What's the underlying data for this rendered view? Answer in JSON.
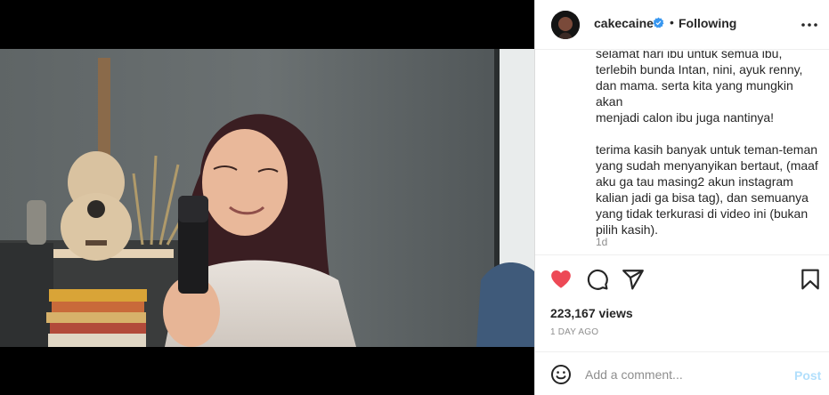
{
  "header": {
    "username": "cakecaine",
    "separator": "•",
    "follow_status": "Following",
    "verified": true
  },
  "caption": {
    "text": "selamat hari ibu untuk semua ibu,\nterlebih bunda Intan, nini, ayuk renny,\ndan mama. serta kita yang mungkin akan\nmenjadi calon ibu juga nantinya!\n\nterima kasih banyak untuk teman-teman\nyang sudah menyanyikan bertaut, (maaf\naku ga tau masing2 akun instagram\nkalian jadi ga bisa tag), dan semuanya\nyang tidak terkurasi di video ini (bukan\npilih kasih).",
    "time": "1d"
  },
  "actions": {
    "liked": true,
    "icons": [
      "heart-icon",
      "comment-icon",
      "share-icon",
      "bookmark-icon"
    ],
    "like_color": "#ed4956"
  },
  "stats": {
    "views": "223,167 views",
    "posted": "1 DAY AGO"
  },
  "comment": {
    "placeholder": "Add a comment...",
    "post_label": "Post",
    "post_color": "#b2dffc"
  },
  "video": {
    "description_icon": "video-frame"
  },
  "colors": {
    "verified_blue": "#3897f0",
    "text": "#262626",
    "muted": "#8e8e8e",
    "border": "#efefef"
  }
}
